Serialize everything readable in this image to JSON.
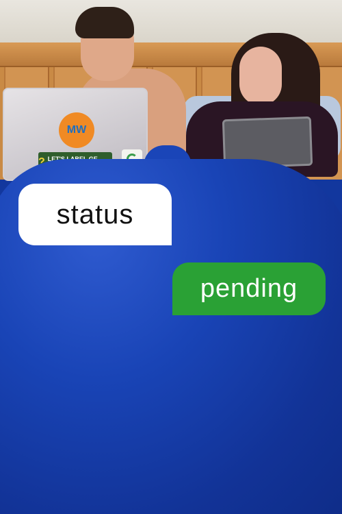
{
  "poster": {
    "bubble_left": "status",
    "bubble_right": "pending",
    "colors": {
      "bubble_left_bg": "#ffffff",
      "bubble_right_bg": "#2aa135",
      "blanket": "#1944b6"
    },
    "stickers": {
      "mw_logo": "MW",
      "label_food": "LET'S LABEL GE FOOD."
    }
  }
}
